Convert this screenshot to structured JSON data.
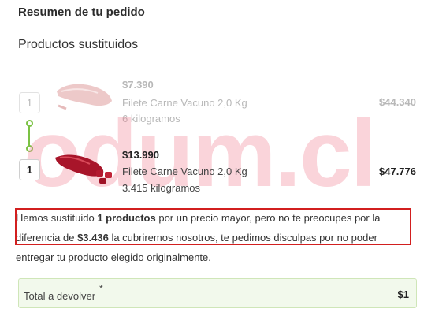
{
  "header": {
    "title": "Resumen de tu pedido",
    "subtitle": "Productos sustituidos"
  },
  "original_product": {
    "quantity": "1",
    "unit_price": "$7.390",
    "name": "Filete Carne Vacuno 2,0 Kg",
    "weight": "6 kilogramos",
    "total": "$44.340"
  },
  "substitute_product": {
    "quantity": "1",
    "unit_price": "$13.990",
    "name": "Filete Carne Vacuno 2,0 Kg",
    "weight": "3.415 kilogramos",
    "total": "$47.776"
  },
  "watermark": "odum.cl",
  "notice": {
    "part1": "Hemos sustituido ",
    "count": "1 productos",
    "part2": " por un precio mayor, pero no te preocupes por la diferencia de ",
    "difference": "$3.436",
    "part3": " la cubriremos nosotros, te pedimos disculpas por no poder entregar tu producto elegido originalmente."
  },
  "refund": {
    "label": "Total a devolver",
    "asterisk": "*",
    "value": "$1"
  },
  "colors": {
    "connector": "#7bc244",
    "highlight_border": "#d21f1f",
    "refund_background": "#f2f9ec"
  }
}
